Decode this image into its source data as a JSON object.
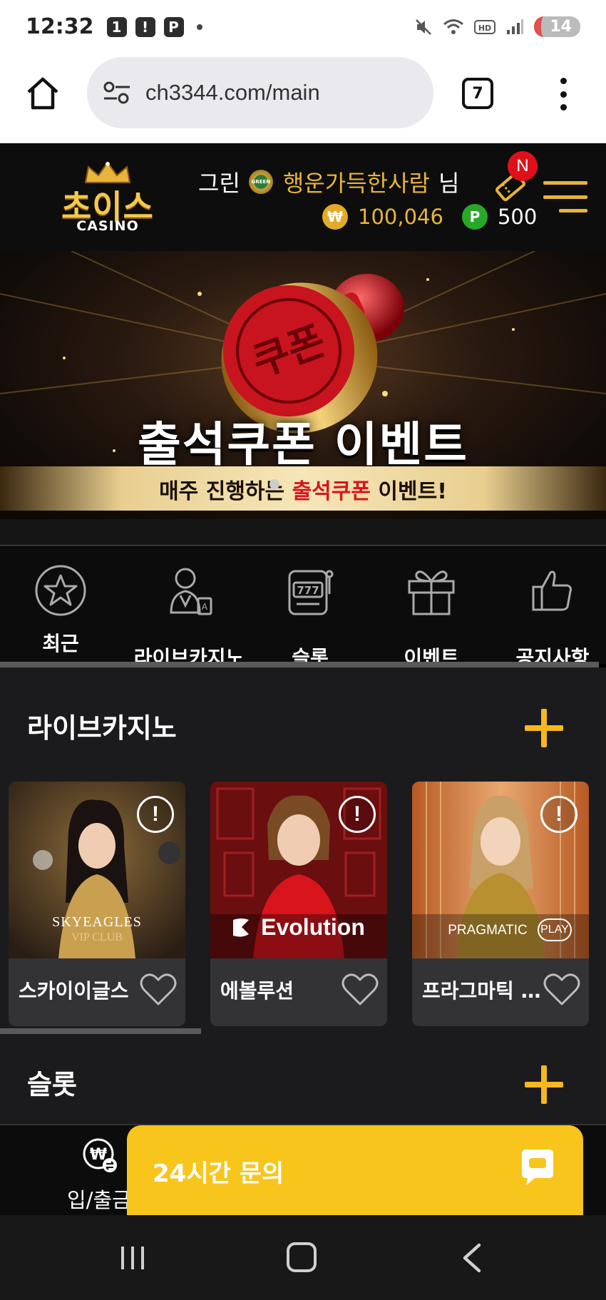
{
  "status_bar": {
    "time": "12:32",
    "badges": [
      "1",
      "!",
      "P"
    ],
    "battery": "14",
    "icons": [
      "mute-icon",
      "wifi-icon",
      "hd-icon",
      "signal-icon"
    ]
  },
  "browser": {
    "url": "ch3344.com/main",
    "tab_count": "7",
    "icons": [
      "home-icon",
      "site-settings-icon",
      "more-vert-icon"
    ]
  },
  "header": {
    "logo_main": "초이스",
    "logo_sub": "CASINO",
    "grade": "그린",
    "grade_badge": "GREEN",
    "nickname": "행운가득한사람",
    "honorific": "님",
    "coin_symbol": "₩",
    "coin_balance": "100,046",
    "point_symbol": "P",
    "point_balance": "500",
    "notification": "N"
  },
  "banner": {
    "title": "출석쿠폰 이벤트",
    "sub_prefix": "매주 진행하는 ",
    "sub_highlight": "출석쿠폰",
    "sub_suffix": " 이벤트!",
    "stamp_text": "쿠폰"
  },
  "categories": [
    {
      "label": "최근",
      "icon": "star-circle-icon"
    },
    {
      "label": "라이브카지노",
      "icon": "dealer-icon"
    },
    {
      "label": "슬롯",
      "icon": "slot-machine-icon"
    },
    {
      "label": "이벤트",
      "icon": "gift-icon"
    },
    {
      "label": "공지사항",
      "icon": "thumbs-up-icon"
    }
  ],
  "live_casino": {
    "title": "라이브카지노",
    "games": [
      {
        "label": "스카이이글스",
        "provider_line1": "SKYEAGLES",
        "provider_line2": "VIP CLUB",
        "info": "!"
      },
      {
        "label": "에볼루션",
        "provider_line1": "Evolution",
        "info": "!"
      },
      {
        "label": "프라그마틱 플레이",
        "provider_line1": "PRAGMATIC",
        "provider_line2": "PLAY",
        "info": "!"
      }
    ]
  },
  "slots": {
    "title": "슬롯"
  },
  "bottom": {
    "deposit_label": "입/출금",
    "chat_label": "24시간 문의"
  },
  "colors": {
    "gold": "#e8b43a",
    "accent_yellow": "#f8c51c",
    "notification_red": "#e0101a",
    "point_green": "#28a828"
  }
}
